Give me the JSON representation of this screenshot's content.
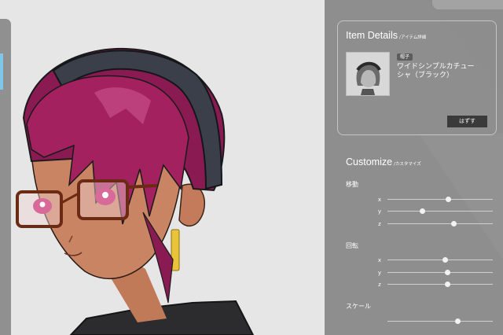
{
  "item_details": {
    "title": "Item Details",
    "subtitle": "/アイテム詳細",
    "badge": "帽子",
    "name": "ワイドシンプルカチューシャ（ブラック）",
    "remove_button": "はずす"
  },
  "customize": {
    "title": "Customize",
    "subtitle": "/カスタマイズ",
    "groups": [
      {
        "label": "移動",
        "axes": [
          {
            "label": "x",
            "value": 0.58
          },
          {
            "label": "y",
            "value": 0.33
          },
          {
            "label": "z",
            "value": 0.63
          }
        ]
      },
      {
        "label": "回転",
        "axes": [
          {
            "label": "x",
            "value": 0.55
          },
          {
            "label": "y",
            "value": 0.57
          },
          {
            "label": "z",
            "value": 0.57
          }
        ]
      },
      {
        "label": "スケール",
        "axes": [
          {
            "value": 0.67
          }
        ]
      }
    ]
  },
  "icons": [
    "headband-thumbnail"
  ]
}
